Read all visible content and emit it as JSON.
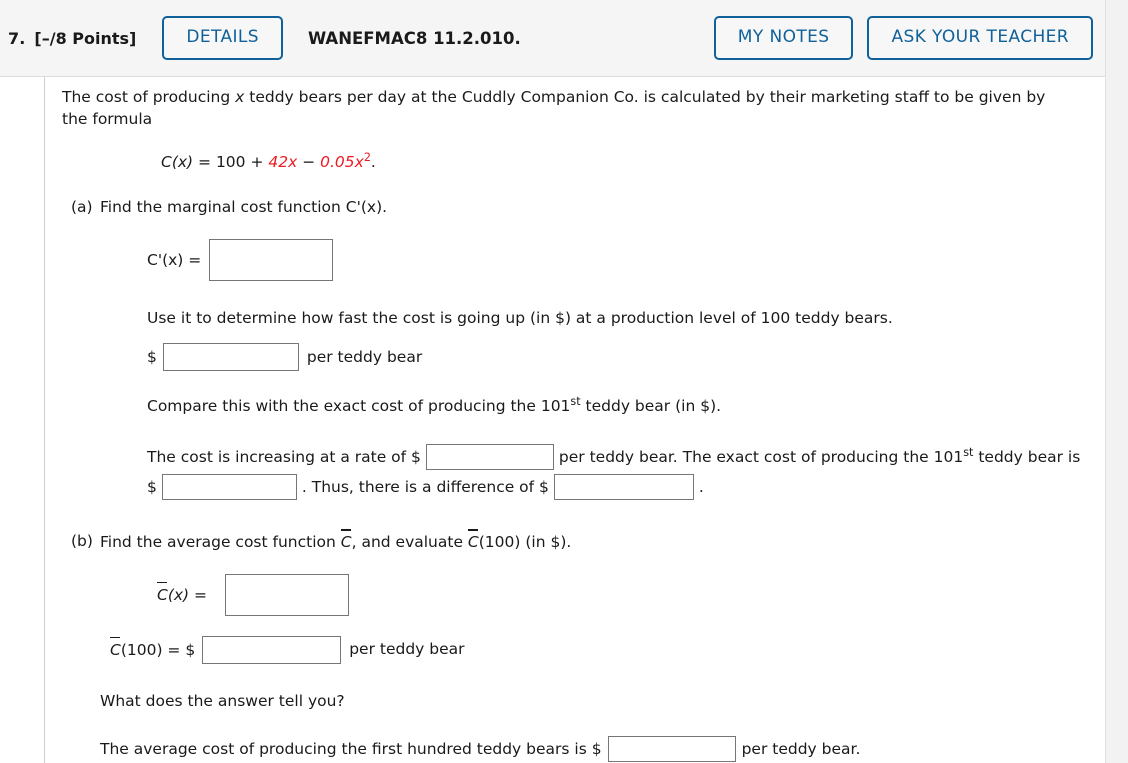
{
  "header": {
    "question_number": "7.",
    "points": "[–/8 Points]",
    "details_label": "DETAILS",
    "assignment_code": "WANEFMAC8 11.2.010.",
    "my_notes_label": "MY NOTES",
    "ask_teacher_label": "ASK YOUR TEACHER"
  },
  "colors": {
    "accent_blue": "#10619a",
    "formula_red": "#ed1b23",
    "header_bg": "#f5f5f5",
    "input_border": "#767676"
  },
  "intro": {
    "text_part1": "The cost of producing ",
    "var_x": "x",
    "text_part2": " teddy bears per day at the Cuddly Companion Co. is calculated by their marketing staff to be given by the formula"
  },
  "formula": {
    "lhs": "C(x)",
    "equals": " = ",
    "constant": "100",
    "plus": " + ",
    "linear_term": "42x",
    "minus": " − ",
    "quad_coeff": "0.05x",
    "quad_exp": "2",
    "period": "."
  },
  "part_a": {
    "label": "(a)",
    "prompt": "Find the marginal cost function C'(x).",
    "answer_label": "C'(x)  =",
    "answer_value": "",
    "rate_prompt": "Use it to determine how fast the cost is going up (in $) at a production level of 100 teddy bears.",
    "dollar": "$",
    "rate_value": "",
    "rate_unit": "per teddy bear",
    "compare_prefix": "Compare this with the exact cost of producing the 101",
    "compare_sup": "st",
    "compare_suffix": " teddy bear (in $).",
    "sentence_1": "The cost is increasing at a rate of $",
    "sentence_1_value": "",
    "sentence_2": "per teddy bear. The exact cost of producing the 101",
    "sentence_2_sup": "st",
    "sentence_3": " teddy bear is",
    "sentence_3_dollar": "$",
    "sentence_3_value": "",
    "sentence_4": ". Thus, there is a difference of $",
    "sentence_4_value": "",
    "sentence_5": "."
  },
  "part_b": {
    "label": "(b)",
    "prompt_pre": "Find the average cost function ",
    "cbar_1": "C",
    "prompt_mid": ", and evaluate ",
    "cbar_2": "C",
    "prompt_post": "(100) (in $).",
    "avg_label_c": "C",
    "avg_label_rest": "(x)   =",
    "avg_value": "",
    "eval_label_c": "C",
    "eval_label_rest": "(100)  = $",
    "eval_value": "",
    "eval_unit": "per teddy bear",
    "question": "What does the answer tell you?",
    "summary_prefix": "The average cost of producing the first hundred teddy bears is $",
    "summary_value": "",
    "summary_suffix": "per teddy bear."
  }
}
